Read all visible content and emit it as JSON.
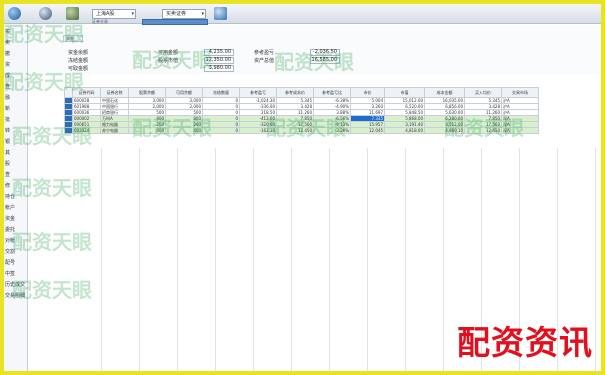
{
  "toolbar": {
    "account_value": "上海A股",
    "view_value": "买卖证券",
    "sublabel": "证券交易"
  },
  "sidebar": {
    "items": [
      "买",
      "卖",
      "撤",
      "资",
      "成",
      "查",
      "融",
      "新",
      "批",
      "转",
      "银",
      "其",
      "股",
      "查",
      "修",
      "持仓",
      "帐户",
      "资金",
      "委托",
      "对帐",
      "交割",
      "配号",
      "中签",
      "历史成交",
      "交易明细"
    ]
  },
  "summary": {
    "tab_label": "资金",
    "rows": [
      {
        "label": "资金余额",
        "field": "可用金额",
        "value": "4,235.00",
        "label2": "参考盈亏",
        "value2": "-2,036.50"
      },
      {
        "label": "冻结金额",
        "field": "股票市值",
        "value": "12,350.00",
        "label2": "资产总值",
        "value2": "16,585.00"
      },
      {
        "label": "可取金额",
        "field": "",
        "value": "3,980.00",
        "label2": "",
        "value2": ""
      }
    ]
  },
  "grid": {
    "headers": [
      "",
      "证券代码",
      "证券名称",
      "股票余额",
      "可用余额",
      "冻结数量",
      "参考盈亏",
      "参考成本价",
      "参考盈亏比",
      "市价",
      "市值",
      "成本金额",
      "买入均价",
      "交易市场"
    ],
    "rows": [
      {
        "style": "plain",
        "cells": [
          "",
          "600028",
          "中国石化",
          "3,000",
          "3,000",
          "0",
          "-1,024.30",
          "5.345",
          "-6.38%",
          "5.004",
          "15,012.00",
          "16,035.00",
          "5.345",
          "沪A"
        ]
      },
      {
        "style": "plain",
        "cells": [
          "",
          "601988",
          "中国银行",
          "2,000",
          "2,000",
          "0",
          "-336.00",
          "3.428",
          "-4.90%",
          "3.260",
          "6,520.00",
          "6,856.00",
          "3.428",
          "沪A"
        ]
      },
      {
        "style": "plain",
        "cells": [
          "",
          "600036",
          "招商银行",
          "500",
          "500",
          "0",
          "218.50",
          "11.260",
          "3.88%",
          "11.697",
          "5,848.50",
          "5,630.00",
          "11.260",
          "沪A"
        ]
      },
      {
        "style": "green",
        "cells": [
          "",
          "000002",
          "万科A",
          "800",
          "800",
          "0",
          "-412.00",
          "7.850",
          "-6.56%",
          "7.335",
          "5,868.00",
          "6,280.00",
          "7.850",
          "深A"
        ]
      },
      {
        "style": "green",
        "cells": [
          "",
          "000651",
          "格力电器",
          "200",
          "200",
          "0",
          "-320.60",
          "17.560",
          "-9.13%",
          "15.957",
          "3,191.40",
          "3,512.00",
          "17.560",
          "深A"
        ]
      },
      {
        "style": "green",
        "cells": [
          "",
          "002024",
          "苏宁电器",
          "400",
          "400",
          "0",
          "-162.10",
          "12.450",
          "-3.26%",
          "12.045",
          "4,818.00",
          "4,980.10",
          "12.450",
          "深A"
        ]
      }
    ],
    "selected_row": 3,
    "selected_col": 9
  },
  "watermarks": {
    "text": "配资天眼",
    "corner_brand": "配资资讯"
  }
}
